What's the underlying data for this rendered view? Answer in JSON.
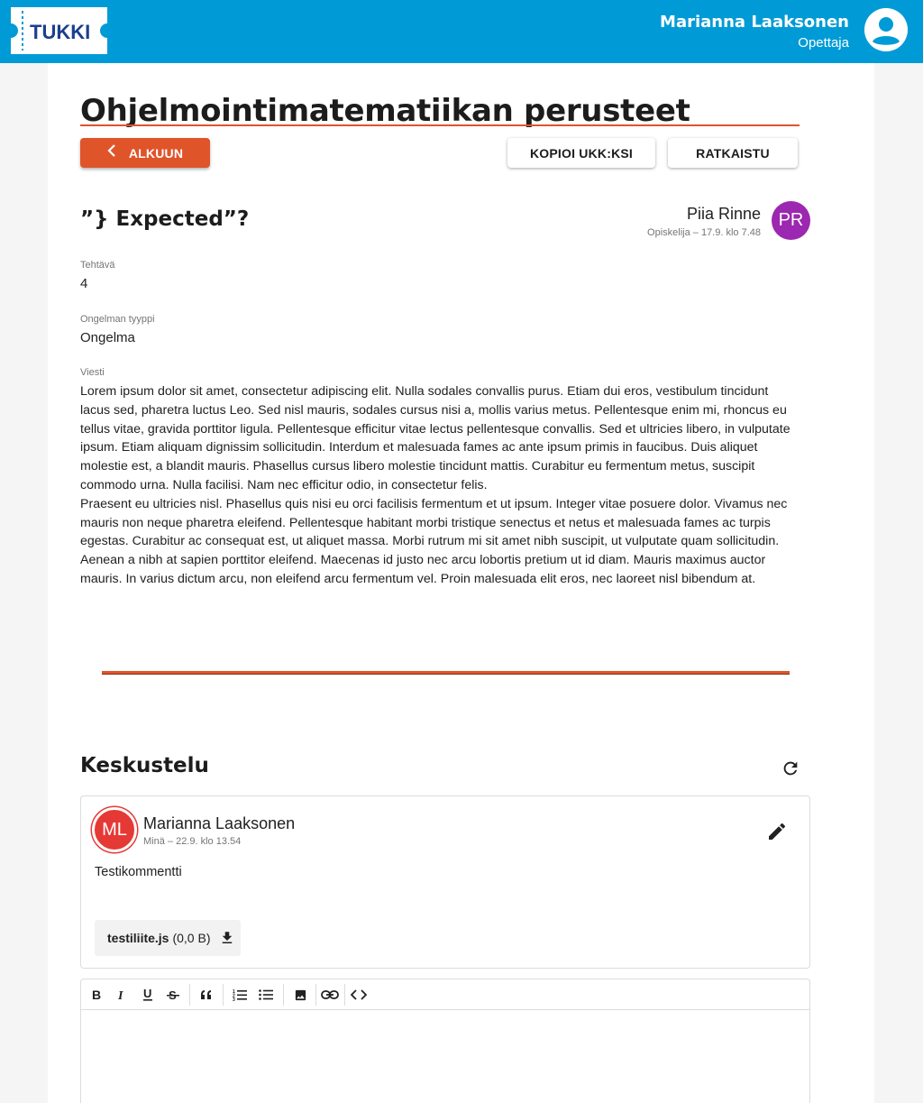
{
  "header": {
    "logo_text": "TUKKI",
    "user_name": "Marianna Laaksonen",
    "user_role": "Opettaja",
    "colors": {
      "appbar": "#009bd6",
      "accent": "#e0542a"
    }
  },
  "course": {
    "title": "Ohjelmointimatematiikan perusteet"
  },
  "actions": {
    "back_label": "ALKUUN",
    "copy_faq_label": "KOPIOI UKK:KSI",
    "solved_label": "RATKAISTU"
  },
  "question": {
    "title": "”} Expected”?",
    "author_name": "Piia Rinne",
    "author_meta": "Opiskelija – 17.9. klo 7.48",
    "author_initials": "PR",
    "fields": {
      "task_label": "Tehtävä",
      "task_value": "4",
      "type_label": "Ongelman tyyppi",
      "type_value": "Ongelma",
      "message_label": "Viesti"
    },
    "message_paragraphs": [
      "Lorem ipsum dolor sit amet, consectetur adipiscing elit. Nulla sodales convallis purus. Etiam dui eros, vestibulum tincidunt lacus sed, pharetra luctus Leo. Sed nisl mauris, sodales cursus nisi a, mollis varius metus. Pellentesque enim mi, rhoncus eu tellus vitae, gravida porttitor ligula. Pellentesque efficitur vitae lectus pellentesque convallis. Sed et ultricies libero, in vulputate ipsum. Etiam aliquam dignissim sollicitudin. Interdum et malesuada fames ac ante ipsum primis in faucibus. Duis aliquet molestie est, a blandit mauris. Phasellus cursus libero molestie tincidunt mattis. Curabitur eu fermentum metus, suscipit commodo urna. Nulla facilisi. Nam nec efficitur odio, in consectetur felis.",
      "Praesent eu ultricies nisl. Phasellus quis nisi eu orci facilisis fermentum et ut ipsum. Integer vitae posuere dolor. Vivamus nec mauris non neque pharetra eleifend. Pellentesque habitant morbi tristique senectus et netus et malesuada fames ac turpis egestas. Curabitur ac consequat est, ut aliquet massa. Morbi rutrum mi sit amet nibh suscipit, ut vulputate quam sollicitudin. Aenean a nibh at sapien porttitor eleifend. Maecenas id justo nec arcu lobortis pretium ut id diam. Mauris maximus auctor mauris. In varius dictum arcu, non eleifend arcu fermentum vel. Proin malesuada elit eros, nec laoreet nisl bibendum at."
    ]
  },
  "discussion": {
    "title": "Keskustelu",
    "comments": [
      {
        "initials": "ML",
        "author": "Marianna Laaksonen",
        "meta": "Minä – 22.9. klo 13.54",
        "text": "Testikommentti",
        "attachment_name": "testiliite.js",
        "attachment_size": "(0,0 B)"
      }
    ]
  },
  "editor": {
    "toolbar": [
      "bold-icon",
      "italic-icon",
      "underline-icon",
      "strikethrough-icon",
      "quote-icon",
      "ordered-list-icon",
      "bullet-list-icon",
      "image-icon",
      "link-icon",
      "code-icon"
    ]
  }
}
